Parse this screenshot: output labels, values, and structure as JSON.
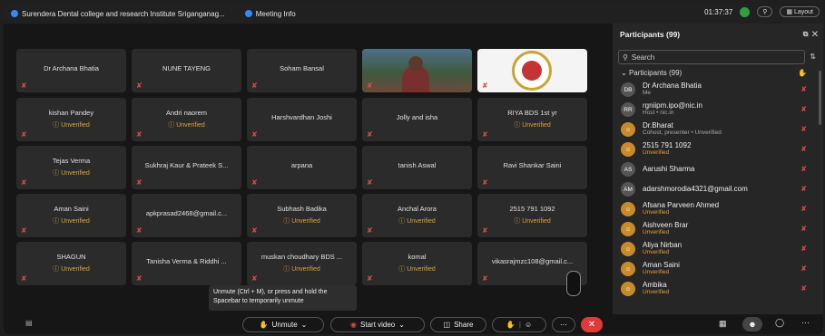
{
  "topbar": {
    "title": "Surendera Dental college and research Institute Sriganganag...",
    "meeting_info": "Meeting Info",
    "timer": "01:37:37",
    "layout_label": "Layout"
  },
  "tiles": [
    {
      "name": "Dr Archana Bhatia",
      "unverified": ""
    },
    {
      "name": "NUNE TAYENG",
      "unverified": ""
    },
    {
      "name": "Soham Bansal",
      "unverified": ""
    },
    {
      "name": "",
      "unverified": ""
    },
    {
      "name": "",
      "unverified": ""
    },
    {
      "name": "kishan Pandey",
      "unverified": "Unverified"
    },
    {
      "name": "Andri naorem",
      "unverified": "Unverified"
    },
    {
      "name": "Harshvardhan Joshi",
      "unverified": ""
    },
    {
      "name": "Jolly and isha",
      "unverified": ""
    },
    {
      "name": "RIYA BDS 1st yr",
      "unverified": "Unverified"
    },
    {
      "name": "Tejas Verma",
      "unverified": "Unverified"
    },
    {
      "name": "Sukhraj Kaur & Prateek S...",
      "unverified": ""
    },
    {
      "name": "arpana",
      "unverified": ""
    },
    {
      "name": "tanish Aswal",
      "unverified": ""
    },
    {
      "name": "Ravi Shankar Saini",
      "unverified": ""
    },
    {
      "name": "Aman Saini",
      "unverified": "Unverified"
    },
    {
      "name": "apkprasad2468@gmail.c...",
      "unverified": ""
    },
    {
      "name": "Subhash Badika",
      "unverified": "Unverified"
    },
    {
      "name": "Anchal Arora",
      "unverified": "Unverified"
    },
    {
      "name": "2515 791 1092",
      "unverified": "Unverified"
    },
    {
      "name": "SHAGUN",
      "unverified": "Unverified"
    },
    {
      "name": "Tanisha Verma & Riddhi ...",
      "unverified": ""
    },
    {
      "name": "muskan choudhary BDS ...",
      "unverified": "Unverified"
    },
    {
      "name": "komal",
      "unverified": "Unverified"
    },
    {
      "name": "vikasrajmzc108@gmail.c...",
      "unverified": ""
    }
  ],
  "tooltip": "Unmute (Ctrl + M), or press and hold the Spacebar to temporarily unmute",
  "bottombar": {
    "unmute": "Unmute",
    "start_video": "Start video",
    "share": "Share"
  },
  "participants": {
    "header": "Participants (99)",
    "search_placeholder": "Search",
    "list_header": "Participants (99)",
    "rows": [
      {
        "initials": "DB",
        "name": "Dr Archana Bhatia",
        "sub": "Me",
        "uv": false
      },
      {
        "initials": "RR",
        "name": "rgniipm.ipo@nic.in",
        "sub": "Host • nic.in",
        "uv": false
      },
      {
        "initials": "",
        "name": "Dr.Bharat",
        "sub": "Cohost, presenter • Unverified",
        "uv": false
      },
      {
        "initials": "",
        "name": "2515 791 1092",
        "sub": "Unverified",
        "uv": true
      },
      {
        "initials": "AS",
        "name": "Aarushi Sharma",
        "sub": "",
        "uv": false
      },
      {
        "initials": "AM",
        "name": "adarshmorodia4321@gmail.com",
        "sub": "",
        "uv": false
      },
      {
        "initials": "",
        "name": "Afsana Parveen Ahmed",
        "sub": "Unverified",
        "uv": true
      },
      {
        "initials": "",
        "name": "Aishveen Brar",
        "sub": "Unverified",
        "uv": true
      },
      {
        "initials": "",
        "name": "Aliya Nirban",
        "sub": "Unverified",
        "uv": true
      },
      {
        "initials": "",
        "name": "Aman Saini",
        "sub": "Unverified",
        "uv": true
      },
      {
        "initials": "",
        "name": "Ambika",
        "sub": "Unverified",
        "uv": true
      }
    ]
  }
}
